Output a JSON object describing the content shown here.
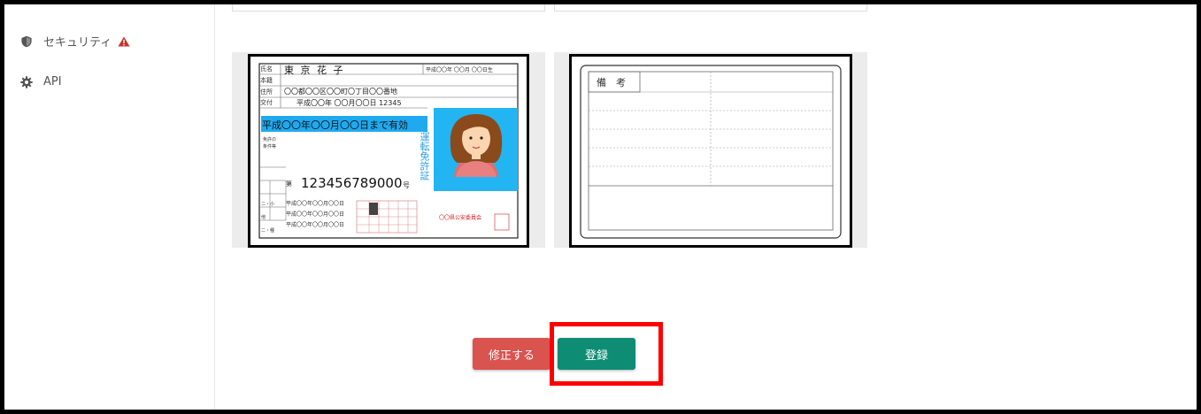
{
  "sidebar": {
    "items": [
      {
        "label": "セキュリティ",
        "icon": "shield-icon",
        "warning": true
      },
      {
        "label": "API",
        "icon": "gear-icon"
      }
    ]
  },
  "license_front": {
    "name": "東 京 花 子",
    "era_label": "平成〇〇年 〇〇月 〇〇日生",
    "row_labels": [
      "氏名",
      "本籍",
      "住所",
      "交付"
    ],
    "address": "〇〇都〇〇区〇〇町〇丁目〇〇番地",
    "issue": "平成〇〇年 〇〇月〇〇日 12345",
    "expiry": "平成〇〇年〇〇月〇〇日まで有効",
    "cond_labels": [
      "免許の",
      "条件等"
    ],
    "number_prefix": "第",
    "number": "123456789000",
    "number_suffix": "号",
    "date_rows": [
      "平成〇〇年〇〇月〇〇日",
      "平成〇〇年〇〇月〇〇日",
      "平成〇〇年〇〇月〇〇日"
    ],
    "side_labels": [
      "二・小",
      "他",
      "二・種"
    ],
    "vertical_title": "運転免許証",
    "authority": "〇〇県公安委員会",
    "colors": {
      "expiry_bg": "#1faaf0",
      "photo_bg": "#22b5f2",
      "title_blue": "#2a9fe0",
      "stamp_red": "#d02020"
    }
  },
  "license_back": {
    "header": "備　考"
  },
  "actions": {
    "fix_label": "修正する",
    "register_label": "登録",
    "fix_color": "#d9534f",
    "register_color": "#0e8c74",
    "highlight_color": "#ff0000"
  }
}
